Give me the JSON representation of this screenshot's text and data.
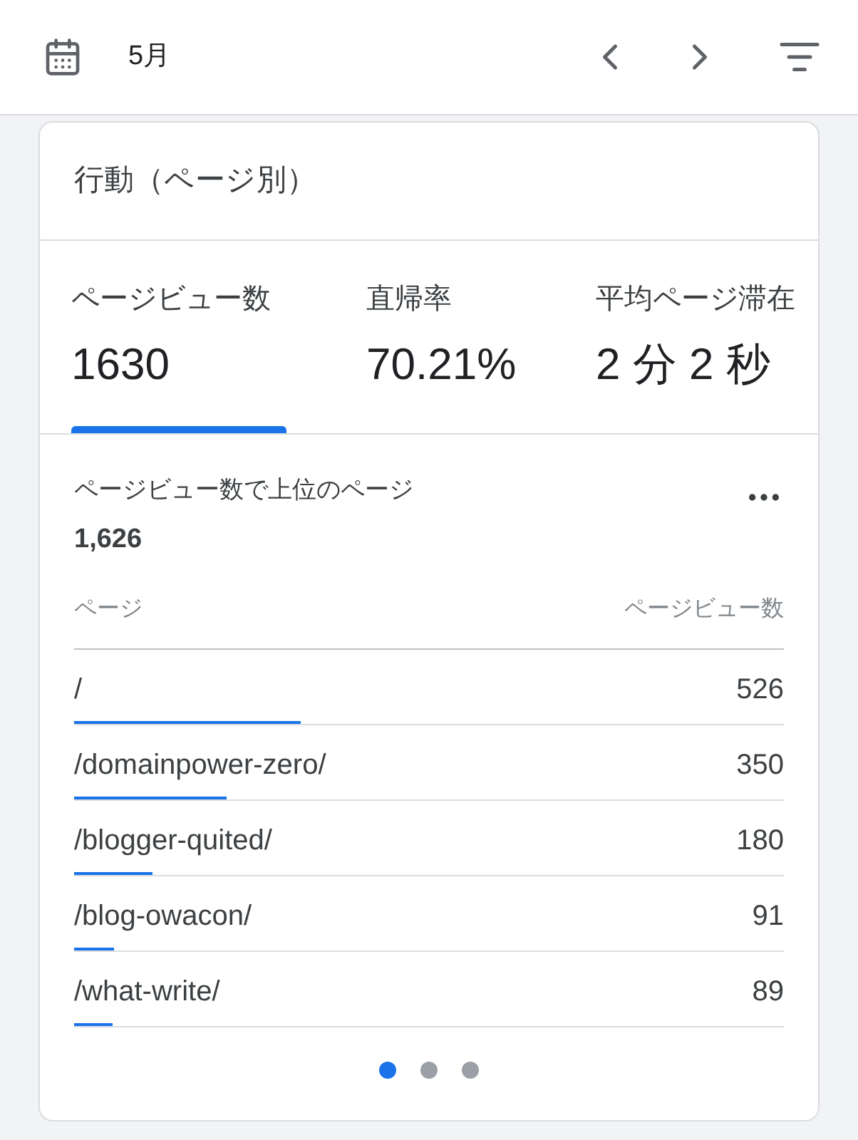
{
  "toolbar": {
    "period": "5月"
  },
  "card": {
    "title": "行動（ページ別）",
    "metrics": [
      {
        "label": "ページビュー数",
        "value": "1630",
        "selected": true
      },
      {
        "label": "直帰率",
        "value": "70.21%",
        "selected": false
      },
      {
        "label": "平均ページ滞在",
        "value": "2 分 2 秒",
        "selected": false
      }
    ],
    "section_title": "ページビュー数で上位のページ",
    "total": "1,626",
    "table": {
      "columns": [
        "ページ",
        "ページビュー数"
      ],
      "rows": [
        {
          "page": "/",
          "views": "526",
          "level": 0.32
        },
        {
          "page": "/domainpower-zero/",
          "views": "350",
          "level": 0.215
        },
        {
          "page": "/blogger-quited/",
          "views": "180",
          "level": 0.11
        },
        {
          "page": "/blog-owacon/",
          "views": "91",
          "level": 0.056
        },
        {
          "page": "/what-write/",
          "views": "89",
          "level": 0.055
        }
      ]
    },
    "pager": [
      {
        "selected": true
      },
      {
        "selected": false
      },
      {
        "selected": false
      }
    ]
  }
}
